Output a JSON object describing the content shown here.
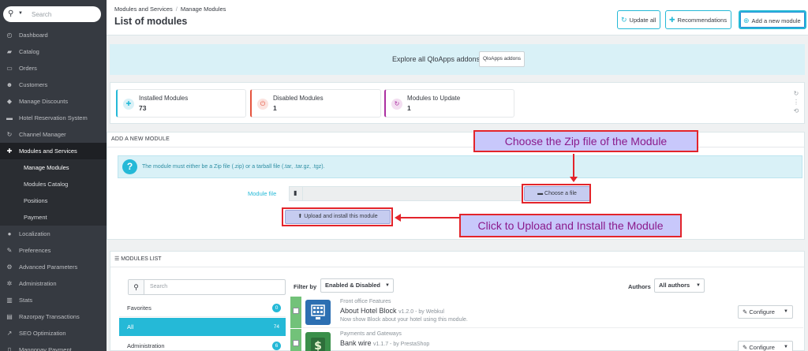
{
  "sidebar": {
    "search_placeholder": "Search",
    "items": [
      {
        "label": "Dashboard",
        "icon": "dashboard-icon",
        "glyph": "◴"
      },
      {
        "label": "Catalog",
        "icon": "catalog-icon",
        "glyph": "▰"
      },
      {
        "label": "Orders",
        "icon": "orders-icon",
        "glyph": "▭"
      },
      {
        "label": "Customers",
        "icon": "customers-icon",
        "glyph": "☻"
      },
      {
        "label": "Manage Discounts",
        "icon": "discount-icon",
        "glyph": "◆"
      },
      {
        "label": "Hotel Reservation System",
        "icon": "bed-icon",
        "glyph": "▬"
      },
      {
        "label": "Channel Manager",
        "icon": "refresh-icon",
        "glyph": "↻"
      },
      {
        "label": "Modules and Services",
        "icon": "puzzle-icon",
        "glyph": "✚"
      },
      {
        "label": "Manage Modules",
        "sub": true
      },
      {
        "label": "Modules Catalog",
        "sub": true
      },
      {
        "label": "Positions",
        "sub": true
      },
      {
        "label": "Payment",
        "sub": true
      },
      {
        "label": "Localization",
        "icon": "globe-icon",
        "glyph": "●"
      },
      {
        "label": "Preferences",
        "icon": "wrench-icon",
        "glyph": "✎"
      },
      {
        "label": "Advanced Parameters",
        "icon": "cogs-icon",
        "glyph": "⚙"
      },
      {
        "label": "Administration",
        "icon": "gear-icon",
        "glyph": "✲"
      },
      {
        "label": "Stats",
        "icon": "bar-chart-icon",
        "glyph": "▥"
      },
      {
        "label": "Razorpay Transactions",
        "icon": "card-icon",
        "glyph": "▤"
      },
      {
        "label": "SEO Optimization",
        "icon": "line-chart-icon",
        "glyph": "↗"
      },
      {
        "label": "Mangopay Payment",
        "icon": "tablet-icon",
        "glyph": "▯"
      }
    ]
  },
  "header": {
    "breadcrumb_parent": "Modules and Services",
    "breadcrumb_current": "Manage Modules",
    "title": "List of modules",
    "update_all": "Update all",
    "recommendations": "Recommendations",
    "add_new_module": "Add a new module"
  },
  "banner": {
    "text": "Explore all QloApps addons",
    "button": "QloApps addons"
  },
  "kpis": [
    {
      "label": "Installed Modules",
      "value": "73",
      "color": "#25b9d7"
    },
    {
      "label": "Disabled Modules",
      "value": "1",
      "color": "#e5533d"
    },
    {
      "label": "Modules to Update",
      "value": "1",
      "color": "#ab30a1"
    }
  ],
  "add_module": {
    "heading": "ADD A NEW MODULE",
    "info": "The module must either be a Zip file (.zip) or a tarball file (.tar, .tar.gz, .tgz).",
    "file_label": "Module file",
    "choose_button": "Choose a file",
    "upload_button": "Upload and install this module"
  },
  "annotations": {
    "choose_zip": "Choose the Zip file of the Module",
    "click_upload": "Click to Upload and Install the Module"
  },
  "modules_list": {
    "heading": "MODULES LIST",
    "search_placeholder": "Search",
    "categories": [
      {
        "label": "Favorites",
        "count": "0"
      },
      {
        "label": "All",
        "count": "74"
      },
      {
        "label": "Administration",
        "count": "6"
      }
    ],
    "filter_by_label": "Filter by",
    "filter_by_value": "Enabled & Disabled",
    "authors_label": "Authors",
    "authors_value": "All authors",
    "modules": [
      {
        "category": "Front office Features",
        "name": "About Hotel Block",
        "version": "v1.2.0 - by Webkul",
        "description": "Now show Block about your hotel using this module.",
        "action": "Configure",
        "icon_color": "#2c6fb2"
      },
      {
        "category": "Payments and Gateways",
        "name": "Bank wire",
        "version": "v1.1.7 - by PrestaShop",
        "description": "",
        "action": "Configure",
        "icon_color": "#3a8f4a"
      }
    ]
  }
}
